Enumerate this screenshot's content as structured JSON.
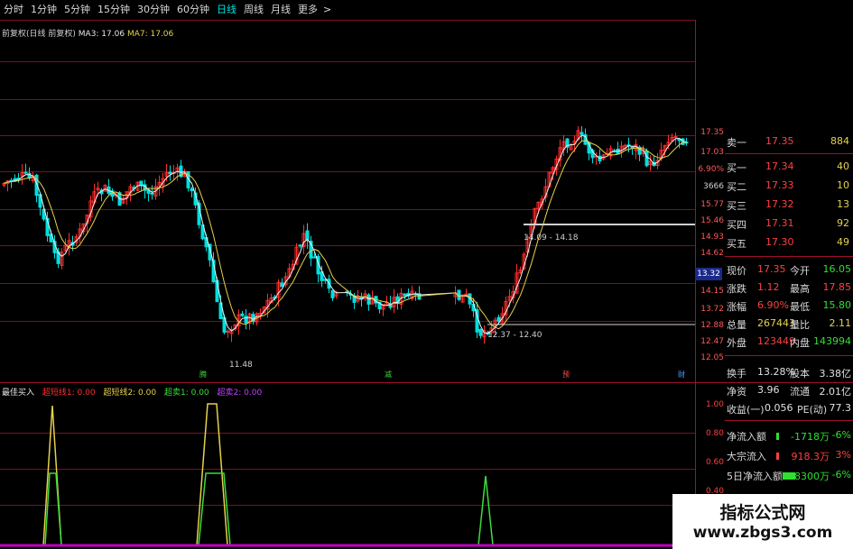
{
  "toolbar": {
    "tabs": [
      "分时",
      "1分钟",
      "5分钟",
      "15分钟",
      "30分钟",
      "60分钟",
      "日线",
      "周线",
      "月线",
      "更多"
    ],
    "active_tab": "日线"
  },
  "main_chart": {
    "title": "前复权(日线 前复权)",
    "ma3_label": "MA3: 17.06",
    "ma7_label": "MA7: 17.06",
    "low_label": "11.48",
    "range_label_1": "12.37 - 12.40",
    "range_label_2": "14.09 - 14.18",
    "current_price": "13.32",
    "price_axis": [
      "17.35",
      "17.03",
      "6.90%",
      "3666",
      "15.77",
      "15.46",
      "14.93",
      "14.62",
      "14.15",
      "13.72",
      "12.88",
      "12.47",
      "12.05"
    ],
    "event_markers": [
      {
        "text": "腾",
        "color": "#3bdc3b"
      },
      {
        "text": "减",
        "color": "#3bdc3b"
      },
      {
        "text": "预",
        "color": "#ff5050"
      },
      {
        "text": "财",
        "color": "#4aa0ff"
      }
    ],
    "colors": {
      "up": "#ff2d2d",
      "down": "#00dede",
      "ma3": "#f0f0f0",
      "ma7": "#e6d24a",
      "level": "#d0d0d0"
    }
  },
  "indicator": {
    "title": "最佳买入",
    "legend": [
      {
        "text": "超短线1: 0.00",
        "color": "#ff3030"
      },
      {
        "text": "超短线2: 0.00",
        "color": "#e6d24a"
      },
      {
        "text": "超卖1: 0.00",
        "color": "#3bdc3b"
      },
      {
        "text": "超卖2: 0.00",
        "color": "#c040ff"
      }
    ],
    "axis": [
      "1.00",
      "0.80",
      "0.60",
      "0.40"
    ],
    "colors": {
      "yellow": "#e6d24a",
      "green": "#3bdc3b",
      "base": "#c000c0"
    }
  },
  "quote_panel": {
    "orderbook": [
      {
        "label": "卖一",
        "price": "17.35",
        "vol": "884"
      },
      {
        "label": "买一",
        "price": "17.34",
        "vol": "40"
      },
      {
        "label": "买二",
        "price": "17.33",
        "vol": "10"
      },
      {
        "label": "买三",
        "price": "17.32",
        "vol": "13"
      },
      {
        "label": "买四",
        "price": "17.31",
        "vol": "92"
      },
      {
        "label": "买五",
        "price": "17.30",
        "vol": "49"
      }
    ],
    "stats": [
      {
        "k1": "现价",
        "v1": "17.35",
        "k2": "今开",
        "v2": "16.05"
      },
      {
        "k1": "涨跌",
        "v1": "1.12",
        "k2": "最高",
        "v2": "17.85"
      },
      {
        "k1": "涨幅",
        "v1": "6.90%",
        "k2": "最低",
        "v2": "15.80"
      },
      {
        "k1": "总量",
        "v1": "267443",
        "k2": "量比",
        "v2": "2.11"
      },
      {
        "k1": "外盘",
        "v1": "123449",
        "k2": "内盘",
        "v2": "143994"
      }
    ],
    "fundamentals": [
      {
        "k1": "换手",
        "v1": "13.28%",
        "k2": "股本",
        "v2": "3.38亿"
      },
      {
        "k1": "净资",
        "v1": "3.96",
        "k2": "流通",
        "v2": "2.01亿"
      },
      {
        "k1": "收益(一)",
        "v1": "0.056",
        "k2": "PE(动)",
        "v2": "77.3"
      }
    ],
    "flows": [
      {
        "label": "净流入额",
        "value": "-1718万",
        "pct": "-6%"
      },
      {
        "label": "大宗流入",
        "value": "918.3万",
        "pct": "3%"
      },
      {
        "label": "5日净流入额",
        "value": "-8300万",
        "pct": "-6%"
      }
    ]
  },
  "watermark": {
    "line1": "指标公式网",
    "line2": "www.zbgs3.com"
  }
}
